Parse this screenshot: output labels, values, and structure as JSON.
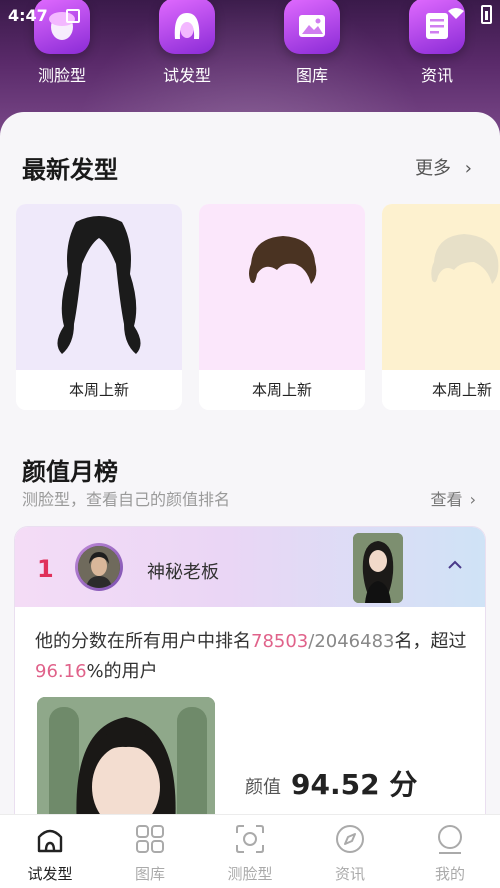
{
  "status_bar": {
    "time": "4:47"
  },
  "quick_actions": [
    {
      "label": "测脸型",
      "icon": "face-icon"
    },
    {
      "label": "试发型",
      "icon": "hair-icon"
    },
    {
      "label": "图库",
      "icon": "gallery-icon"
    },
    {
      "label": "资讯",
      "icon": "news-icon"
    }
  ],
  "latest": {
    "title": "最新发型",
    "more": "更多",
    "cards": [
      {
        "caption": "本周上新",
        "bg": "#efe9fa",
        "hair_color": "#1b1b1b"
      },
      {
        "caption": "本周上新",
        "bg": "#fbe7fb",
        "hair_color": "#4a3322"
      },
      {
        "caption": "本周上新",
        "bg": "#fdf1cf",
        "hair_color": "#e7e0c8"
      }
    ]
  },
  "ranking": {
    "title": "颜值月榜",
    "subtitle": "测脸型，查看自己的颜值排名",
    "check": "查看",
    "entry": {
      "rank": "1",
      "name": "神秘老板",
      "sentence_prefix": "他的分数在所有用户中排名",
      "rank_position": "78503",
      "rank_total": "/2046483",
      "sentence_mid": "名，超过",
      "percent": "96.16",
      "sentence_suffix": "%的用户",
      "score_label": "颜值",
      "score": "94.52 分"
    }
  },
  "bottom_nav": [
    {
      "label": "试发型",
      "icon": "hairstyle-icon",
      "active": true
    },
    {
      "label": "图库",
      "icon": "grid-icon",
      "active": false
    },
    {
      "label": "测脸型",
      "icon": "scan-face-icon",
      "active": false
    },
    {
      "label": "资讯",
      "icon": "compass-icon",
      "active": false
    },
    {
      "label": "我的",
      "icon": "profile-icon",
      "active": false
    }
  ],
  "colors": {
    "accent": "#e0628a",
    "rank_red": "#e0305a",
    "header_purple": "#5a2a6a"
  }
}
